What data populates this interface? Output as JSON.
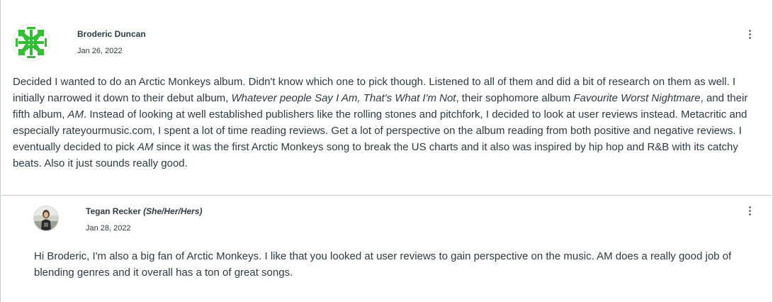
{
  "main_post": {
    "author": "Broderic Duncan",
    "date": "Jan 26, 2022",
    "avatar_icon": "green-snowflake-avatar-icon",
    "menu_icon": "kebab-menu-icon",
    "body": {
      "p1": "Decided I wanted to do an Arctic Monkeys album. Didn't know which one to pick though. Listened to all of them and did a bit of research on them as well.  I initially narrowed it down to their debut album, ",
      "i1": "Whatever people Say I Am, That's What I'm Not",
      "p2": ", their sophomore album ",
      "i2": "Favourite Worst Nightmare",
      "p3": ", and their fifth album, ",
      "i3": "AM",
      "p4": ". Instead of looking at well established publishers like the rolling stones and pitchfork, I decided to look at user reviews instead. Metacritic and especially rateyourmusic.com, I spent a lot of time reading reviews. Get a lot of perspective on the album reading from both positive and negative reviews. I eventually decided to pick ",
      "i4": "AM",
      "p5": " since it was the first Arctic Monkeys song to break the US charts and it also was inspired by hip hop and R&B with its catchy beats. Also it just sounds really good."
    }
  },
  "reply": {
    "author": "Tegan Recker",
    "pronouns": "(She/Her/Hers)",
    "date": "Jan 28, 2022",
    "avatar_icon": "user-photo-avatar-icon",
    "menu_icon": "kebab-menu-icon",
    "body": "Hi Broderic, I'm also a big fan of Arctic Monkeys. I like that you looked at user reviews to gain perspective on the music. AM does a really good job of blending genres and it overall has a ton of great songs."
  },
  "colors": {
    "text": "#2d3b45",
    "border": "#c7cdd1",
    "avatar_green": "#2fc12f"
  }
}
